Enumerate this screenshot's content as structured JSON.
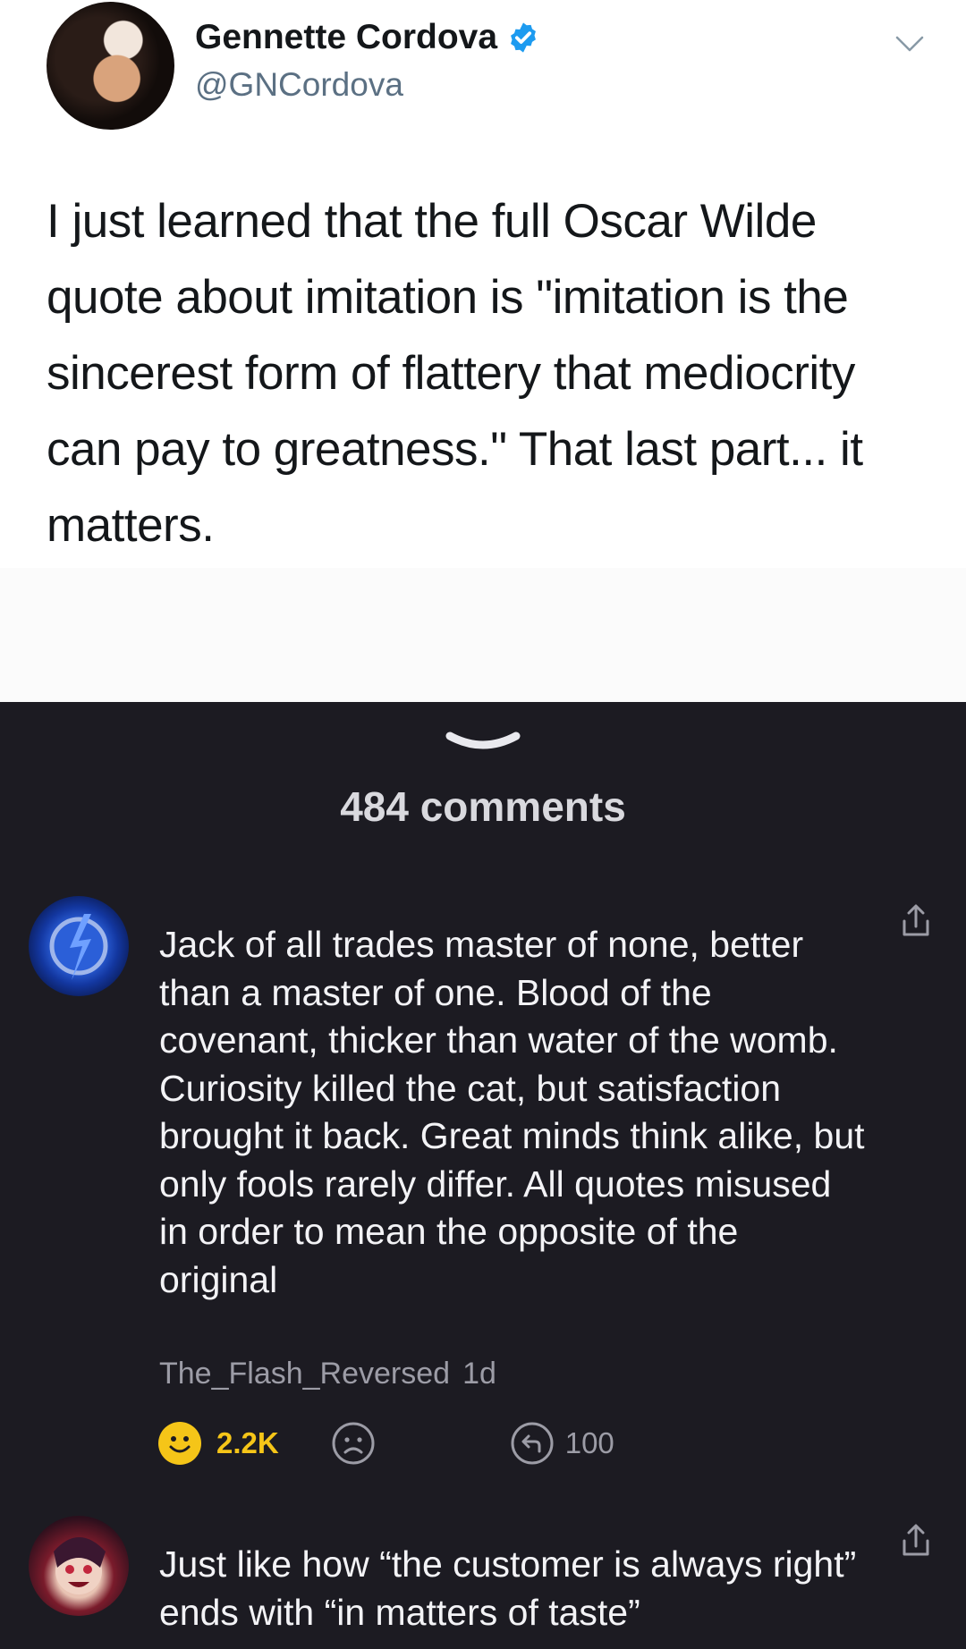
{
  "tweet": {
    "name": "Gennette Cordova",
    "handle": "@GNCordova",
    "text": "I just learned that the full Oscar Wilde quote about imitation is \"imitation is the sincerest form of flattery that mediocrity can pay to greatness.\" That last part... it matters.",
    "verified_color": "#1d9bf0"
  },
  "comments_section": {
    "count_label": "484 comments",
    "comments": [
      {
        "text": "Jack of all trades master of none, better than a master of one. Blood of the covenant, thicker than water of the womb. Curiosity killed the cat, but satisfaction brought it back. Great minds think alike, but only fools rarely differ. All quotes misused in order to mean the opposite of the original",
        "author": "The_Flash_Reversed",
        "time": "1d",
        "likes": "2.2K",
        "replies": "100"
      },
      {
        "text": "Just like how “the customer is always right” ends with “in matters of taste”"
      }
    ]
  },
  "colors": {
    "like_yellow": "#f5c518",
    "dark_bg": "#1c1b22"
  }
}
